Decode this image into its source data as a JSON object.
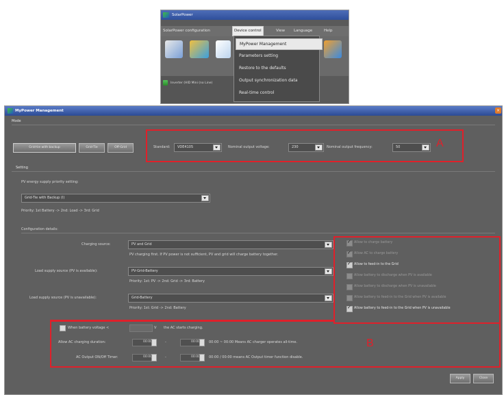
{
  "inset": {
    "title": "SolarPower",
    "menus": [
      "SolarPower configuration",
      "Device control",
      "View",
      "Language",
      "Help"
    ],
    "dropdown": [
      "MyPower Management",
      "Parameters setting",
      "Restore to the defaults",
      "Output synchronization data",
      "Real-time control"
    ],
    "bottom_text": "Inverter (HID Mini (no Line)"
  },
  "window": {
    "title": "MyPower Management",
    "close": "×"
  },
  "mode": {
    "heading": "Mode",
    "buttons": [
      "Grid-tie with backup",
      "Grid-Tie",
      "Off-Grid"
    ],
    "standard_label": "Standard:",
    "standard_value": "VDE4105",
    "voltage_label": "Nominal output voltage:",
    "voltage_value": "230",
    "freq_label": "Nominal output frequency:",
    "freq_value": "50"
  },
  "setting": {
    "heading": "Setting",
    "pv_priority_label": "PV energy supply priority setting:",
    "pv_priority_value": "Grid-Tie with Backup (I)",
    "priority_text": "Priority: 1st Battery -> 2nd: Load -> 3rd: Grid"
  },
  "config": {
    "heading": "Configuration details:",
    "charging_label": "Charging source:",
    "charging_value": "PV and Grid",
    "charging_desc": "PV charging first. If PV power is not sufficient, PV and grid will charge battery together.",
    "load_avail_label": "Load supply source (PV is available):",
    "load_avail_value": "PV-Grid-Battery",
    "load_avail_desc": "Priority: 1st: PV -> 2nd: Grid -> 3rd: Battery",
    "load_unavail_label": "Load supply source (PV is unavailable):",
    "load_unavail_value": "Grid-Battery",
    "load_unavail_desc": "Priority: 1st: Grid -> 2nd: Battery"
  },
  "options": [
    {
      "label": "Allow to charge battery",
      "checked": true,
      "enabled": false
    },
    {
      "label": "Allow AC to charge battery",
      "checked": true,
      "enabled": false
    },
    {
      "label": "Allow to feed-in to the Grid",
      "checked": true,
      "enabled": true
    },
    {
      "label": "Allow battery to discharge when PV is available",
      "checked": false,
      "enabled": false
    },
    {
      "label": "Allow battery to discharge when PV is unavailable",
      "checked": false,
      "enabled": false
    },
    {
      "label": "Allow battery to feed-in to the Grid when PV is available",
      "checked": false,
      "enabled": false
    },
    {
      "label": "Allow battery to feed-in to the Grid when PV is unavailable",
      "checked": true,
      "enabled": true
    }
  ],
  "battery_row": {
    "label": "When battery voltage <",
    "value": "",
    "unit": "V",
    "suffix": "the AC starts charging."
  },
  "ac_charging_row": {
    "label": "Allow AC charging duration:",
    "start": "00:00",
    "dash": "-",
    "end": "00:00",
    "note": "00:00 ~ 00:00 Means AC charger operates all-time."
  },
  "ac_output_row": {
    "label": "AC Output ON/Off Timer:",
    "start": "00:00",
    "dash": "-",
    "end": "00:00",
    "note": "00:00 / 00:00 means AC Output timer function disable."
  },
  "annotations": {
    "a": "A",
    "b": "B"
  },
  "footer": {
    "apply": "Apply",
    "close": "Close"
  },
  "colors": {
    "annotation": "#e0202a",
    "title_bar": "#2b4a94",
    "panel": "#5f5f5f"
  }
}
